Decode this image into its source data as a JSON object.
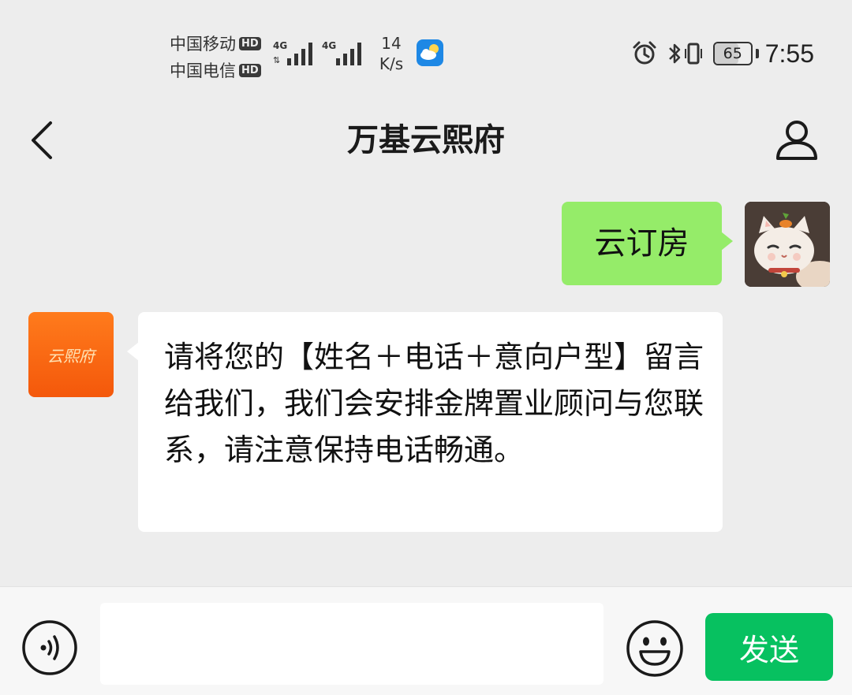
{
  "status_bar": {
    "carrier_1": "中国移动",
    "carrier_2": "中国电信",
    "hd_label": "HD",
    "network_type": "4G",
    "net_speed_value": "14",
    "net_speed_unit": "K/s",
    "battery_level": "65",
    "battery_fraction": 0.65,
    "time": "7:55",
    "icons": [
      "alarm-icon",
      "bluetooth-icon",
      "vibrate-icon",
      "weather-icon"
    ]
  },
  "header": {
    "title": "万基云熙府",
    "back_icon": "chevron-left-icon",
    "profile_icon": "person-icon"
  },
  "messages": [
    {
      "direction": "sent",
      "text": "云订房",
      "avatar": "cat-avatar"
    },
    {
      "direction": "received",
      "text": "请将您的【姓名＋电话＋意向户型】留言给我们，我们会安排金牌置业顾问与您联系，请注意保持电话畅通。",
      "avatar_label": "云熙府"
    }
  ],
  "input_bar": {
    "input_value": "",
    "send_label": "发送",
    "voice_icon": "voice-icon",
    "emoji_icon": "smiley-icon"
  },
  "colors": {
    "background": "#ededed",
    "sent_bubble": "#95ec69",
    "received_bubble": "#ffffff",
    "send_button": "#07c160",
    "bot_avatar": "#f4580b"
  }
}
